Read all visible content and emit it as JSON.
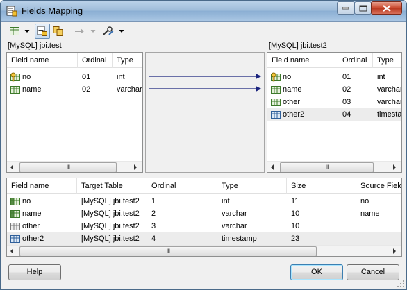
{
  "window": {
    "title": "Fields Mapping"
  },
  "source": {
    "label": "[MySQL] jbi.test",
    "columns": [
      "Field name",
      "Ordinal",
      "Type"
    ],
    "rows": [
      {
        "name": "no",
        "ordinal": "01",
        "type": "int",
        "icon": "key-field-icon"
      },
      {
        "name": "name",
        "ordinal": "02",
        "type": "varchar",
        "icon": "field-icon"
      }
    ]
  },
  "target": {
    "label": "[MySQL] jbi.test2",
    "columns": [
      "Field name",
      "Ordinal",
      "Type"
    ],
    "rows": [
      {
        "name": "no",
        "ordinal": "01",
        "type": "int",
        "icon": "key-field-icon"
      },
      {
        "name": "name",
        "ordinal": "02",
        "type": "varchar",
        "icon": "field-icon"
      },
      {
        "name": "other",
        "ordinal": "03",
        "type": "varchar",
        "icon": "field-icon"
      },
      {
        "name": "other2",
        "ordinal": "04",
        "type": "timestamp",
        "icon": "field-blue-icon"
      }
    ]
  },
  "mapping": {
    "columns": [
      "Field name",
      "Target Table",
      "Ordinal",
      "Type",
      "Size",
      "Source Field"
    ],
    "rows": [
      {
        "name": "no",
        "table": "[MySQL] jbi.test2",
        "ordinal": "1",
        "type": "int",
        "size": "11",
        "source": "no",
        "icon": "mapped-field-icon"
      },
      {
        "name": "name",
        "table": "[MySQL] jbi.test2",
        "ordinal": "2",
        "type": "varchar",
        "size": "10",
        "source": "name",
        "icon": "mapped-field-icon"
      },
      {
        "name": "other",
        "table": "[MySQL] jbi.test2",
        "ordinal": "3",
        "type": "varchar",
        "size": "10",
        "source": "",
        "icon": "unmapped-field-icon"
      },
      {
        "name": "other2",
        "table": "[MySQL] jbi.test2",
        "ordinal": "4",
        "type": "timestamp",
        "size": "23",
        "source": "",
        "icon": "unmapped-field-blue-icon"
      }
    ]
  },
  "buttons": {
    "help": {
      "accel": "H",
      "rest": "elp"
    },
    "ok": {
      "accel": "O",
      "rest": "K"
    },
    "cancel": {
      "accel": "C",
      "rest": "ancel"
    }
  },
  "scroll_grip": "III",
  "colors": {
    "accent": "#1a237e",
    "selected_row": "#ececec"
  }
}
